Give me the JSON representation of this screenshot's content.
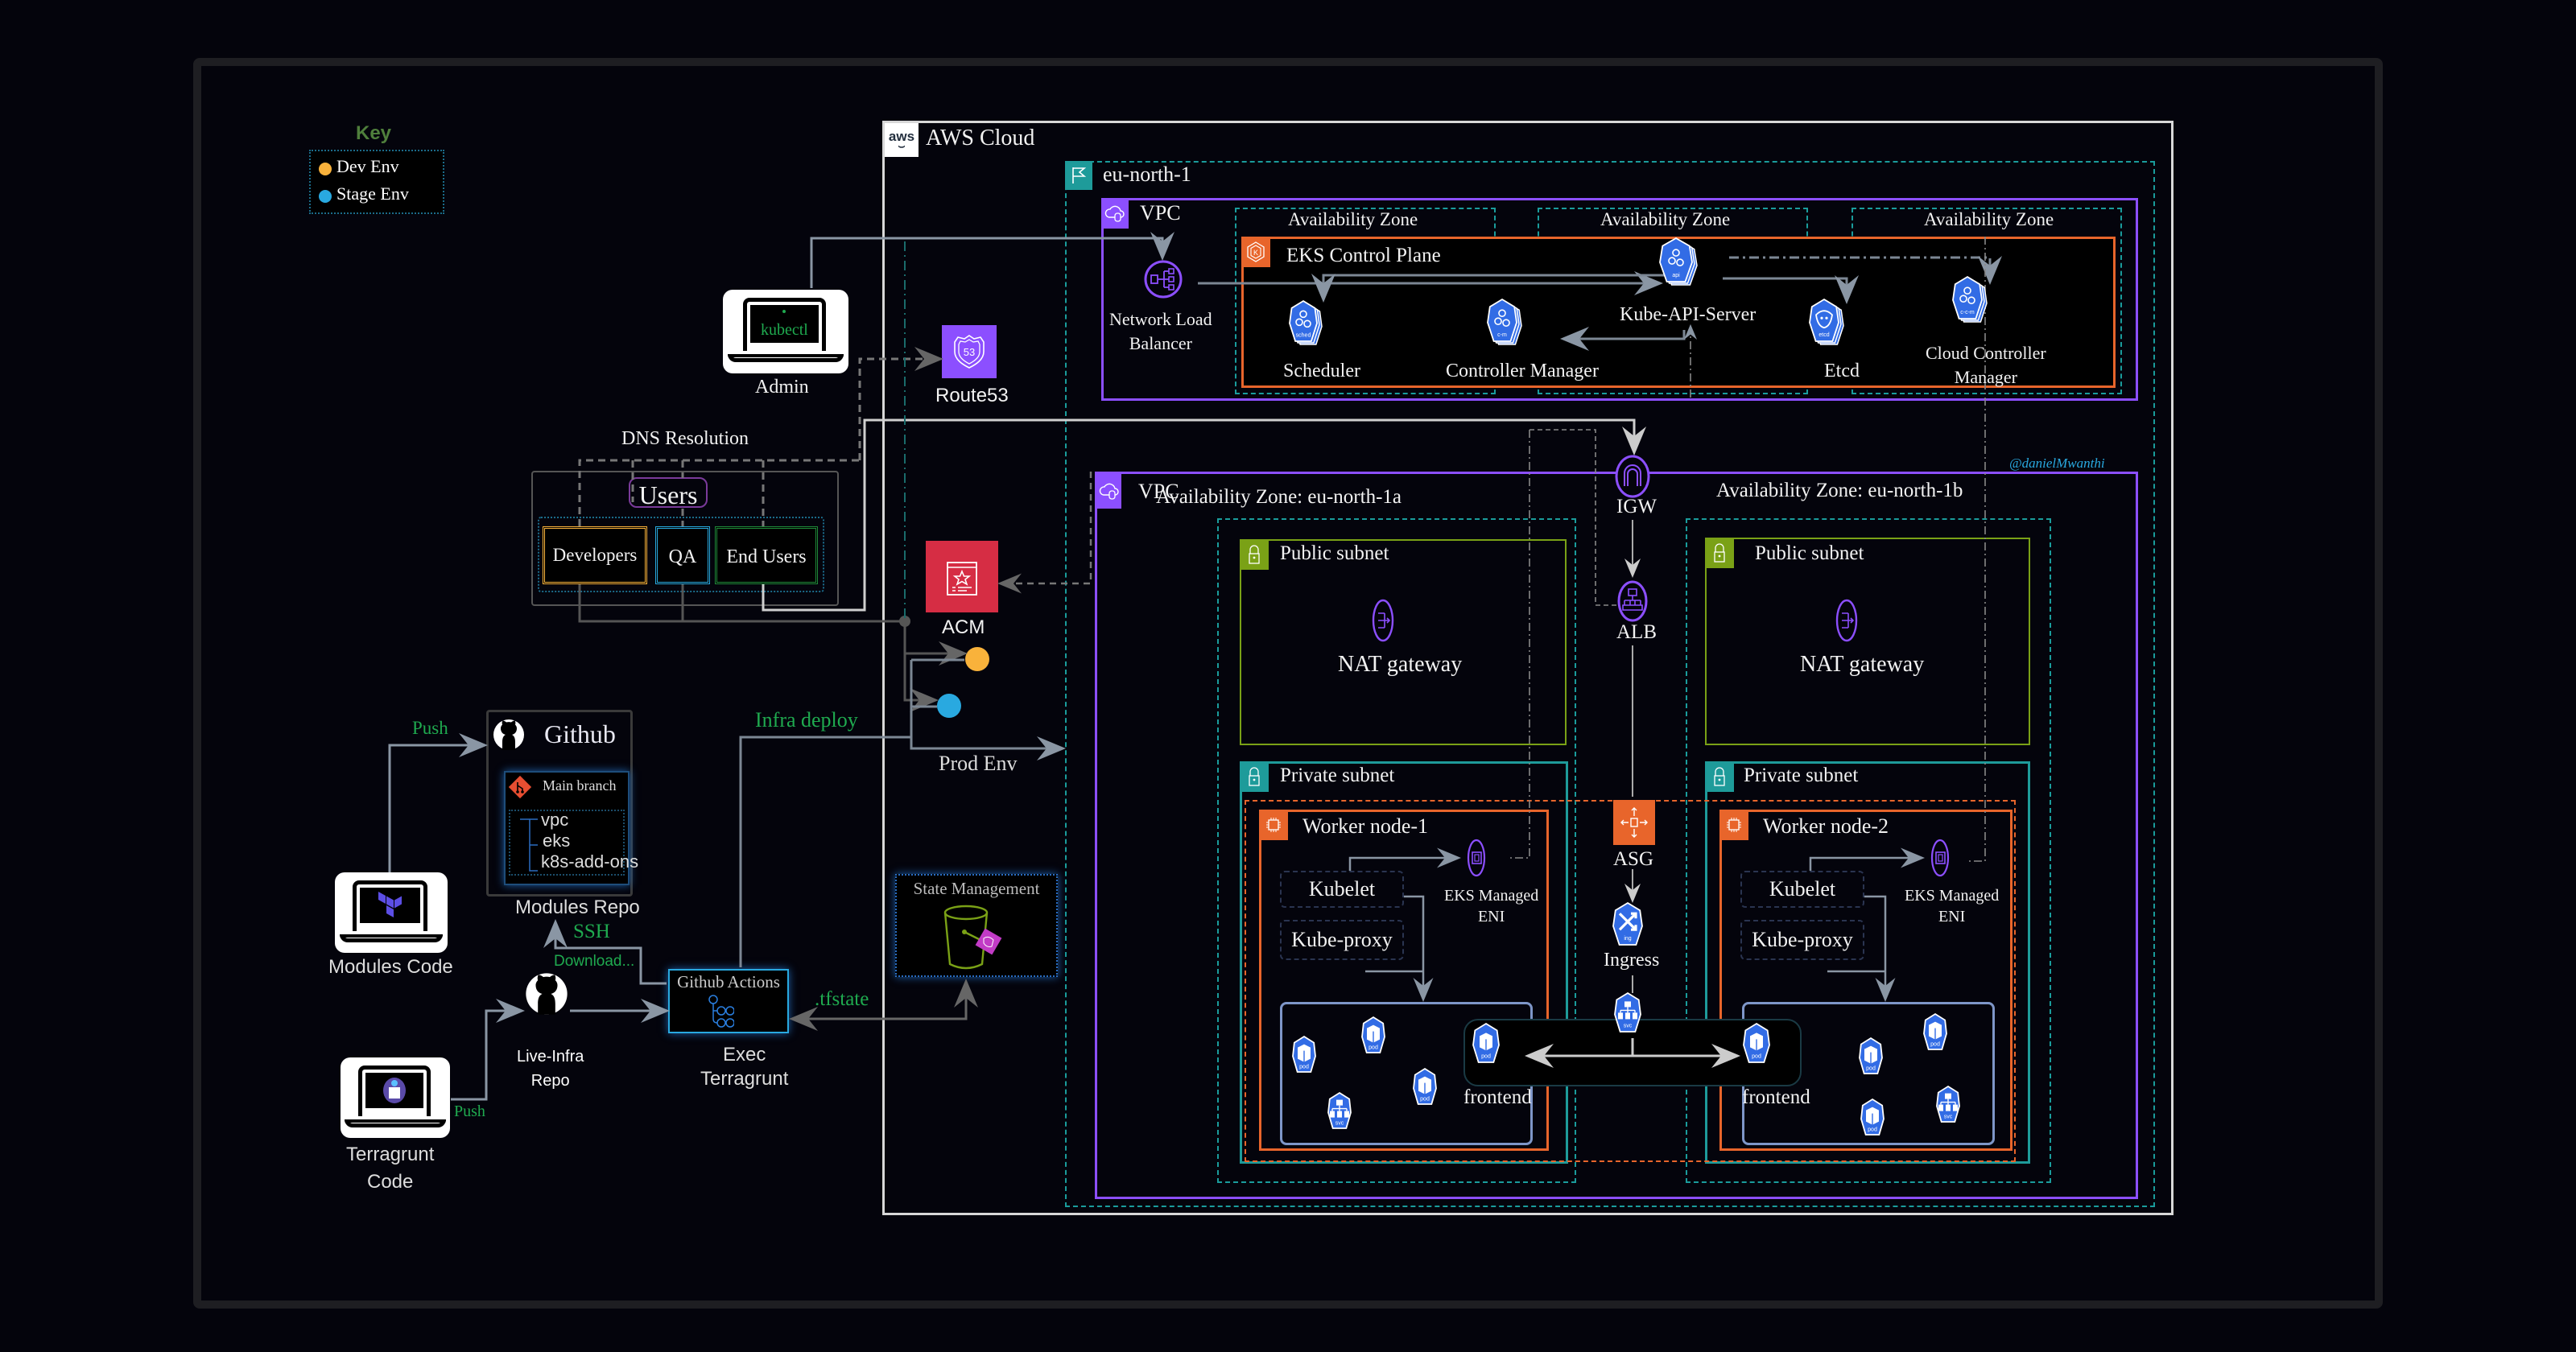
{
  "key": {
    "title": "Key",
    "items": [
      {
        "label": "Dev Env",
        "color": "#f9b23b"
      },
      {
        "label": "Stage Env",
        "color": "#29a9e0"
      }
    ]
  },
  "admin": {
    "screen_text": "kubectl",
    "label": "Admin"
  },
  "route53": {
    "label": "Route53",
    "badge": "53"
  },
  "dns": {
    "label": "DNS Resolution"
  },
  "users": {
    "title": "Users",
    "groups": [
      {
        "label": "Developers",
        "color": "#f9b23b"
      },
      {
        "label": "QA",
        "color": "#29a9e0"
      },
      {
        "label": "End Users",
        "color": "#1f8a3a"
      }
    ]
  },
  "acm": {
    "label": "ACM"
  },
  "prod_env": {
    "label": "Prod Env"
  },
  "github": {
    "title": "Github",
    "branch": "Main branch",
    "modules": [
      "vpc",
      "eks",
      "k8s-add-ons"
    ],
    "caption": "Modules Repo"
  },
  "pipeline": {
    "push_top": "Push",
    "push_bottom": "Push",
    "infra_deploy": "Infra deploy",
    "ssh": "SSH",
    "download": "Download...",
    "tfstate": ".tfstate",
    "modules_code": "Modules Code",
    "terragrunt_code": [
      "Terragrunt",
      "Code"
    ],
    "live_infra": [
      "Live-Infra",
      "Repo"
    ],
    "actions_title": "Github Actions",
    "exec": [
      "Exec",
      "Terragrunt"
    ],
    "state_management": "State Management"
  },
  "aws": {
    "cloud_label": "AWS Cloud",
    "aws_badge": "aws",
    "region": "eu-north-1",
    "watermark": "@danielMwanthi",
    "control_vpc": {
      "label": "VPC",
      "nlb": [
        "Network Load",
        "Balancer"
      ],
      "az_labels": [
        "Availability Zone",
        "Availability Zone",
        "Availability Zone"
      ],
      "eks_label": "EKS Control Plane",
      "components": [
        {
          "name": "Kube-API-Server",
          "tag": "api"
        },
        {
          "name": "Scheduler",
          "tag": "sched"
        },
        {
          "name": "Controller Manager",
          "tag": "c-m"
        },
        {
          "name": "Etcd",
          "tag": "etcd"
        },
        {
          "name": "Cloud Controller Manager",
          "tag": "c-c-m"
        }
      ]
    },
    "data_vpc": {
      "label": "VPC",
      "igw": "IGW",
      "alb": "ALB",
      "asg": "ASG",
      "ingress": "Ingress",
      "ingress_tag": "ing",
      "svc_tag": "svc",
      "pod_tag": "pod",
      "zones": [
        {
          "label": "Availability Zone: eu-north-1a",
          "public_subnet": "Public subnet",
          "nat": "NAT gateway",
          "private_subnet": "Private subnet",
          "worker": "Worker node-1",
          "kubelet": "Kubelet",
          "kube_proxy": "Kube-proxy",
          "eni": [
            "EKS Managed",
            "ENI"
          ],
          "frontend": "frontend"
        },
        {
          "label": "Availability Zone: eu-north-1b",
          "public_subnet": "Public subnet",
          "nat": "NAT gateway",
          "private_subnet": "Private subnet",
          "worker": "Worker node-2",
          "kubelet": "Kubelet",
          "kube_proxy": "Kube-proxy",
          "eni": [
            "EKS Managed",
            "ENI"
          ],
          "frontend": "frontend"
        }
      ]
    }
  }
}
